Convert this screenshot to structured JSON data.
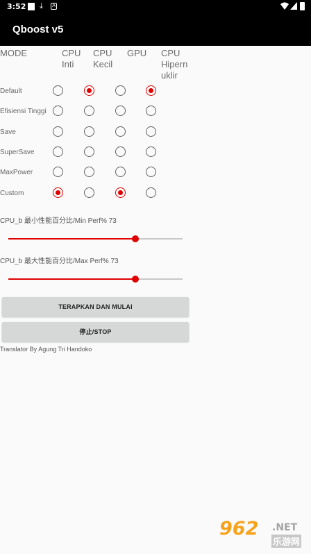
{
  "status_bar": {
    "time": "3:52",
    "icons": [
      "square-icon",
      "download-icon",
      "a-icon",
      "wifi-icon",
      "signal-icon",
      "battery-icon"
    ]
  },
  "app": {
    "title": "Qboost v5"
  },
  "columns": {
    "mode": "MODE",
    "cpu_inti": "CPU\nInti",
    "cpu_kecil": "CPU\nKecil",
    "gpu": "GPU",
    "cpu_hipernuklir": "CPU\nHipern\nuklir"
  },
  "rows": [
    {
      "label": "Default",
      "selected": [
        false,
        true,
        false,
        true
      ]
    },
    {
      "label": "Efisiensi Tinggi",
      "selected": [
        false,
        false,
        false,
        false
      ]
    },
    {
      "label": "Save",
      "selected": [
        false,
        false,
        false,
        false
      ]
    },
    {
      "label": "SuperSave",
      "selected": [
        false,
        false,
        false,
        false
      ]
    },
    {
      "label": "MaxPower",
      "selected": [
        false,
        false,
        false,
        false
      ]
    },
    {
      "label": "Custom",
      "selected": [
        true,
        false,
        true,
        false
      ]
    }
  ],
  "sliders": {
    "min": {
      "caption": "CPU_b 最小性能百分比/Min Perf% 73",
      "value_percent": 73
    },
    "max": {
      "caption": "CPU_b 最大性能百分比/Max Perf% 73",
      "value_percent": 73
    }
  },
  "buttons": {
    "apply": "TERAPKAN DAN MULAI",
    "stop": "停止/STOP"
  },
  "credit": "Translator By Agung Tri Handoko",
  "watermark": {
    "number": "962",
    "suffix": ".NET",
    "cn": "乐游网"
  },
  "colors": {
    "accent": "#e00000",
    "appbar": "#000000",
    "button": "#d6d7d7"
  }
}
